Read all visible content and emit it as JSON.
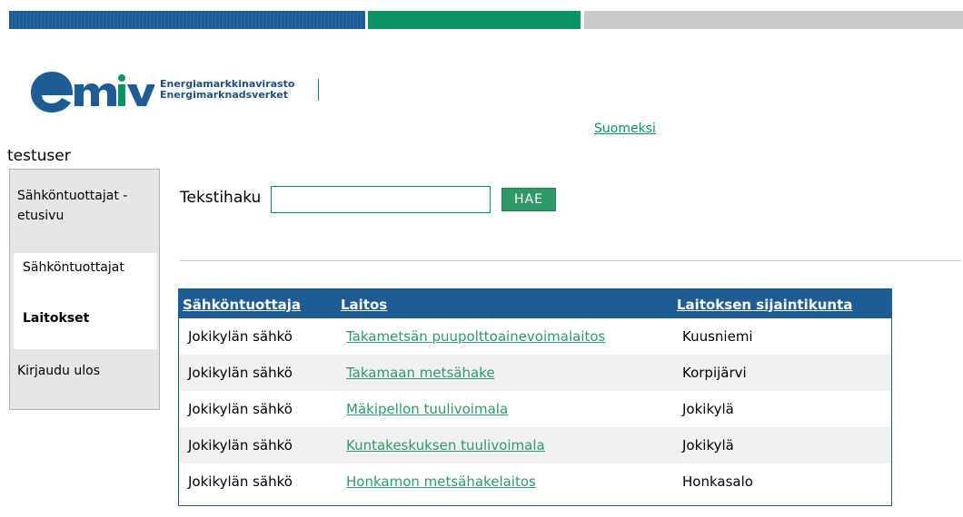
{
  "header": {
    "logo_line1": "Energiamarkkinavirasto",
    "logo_line2": "Energimarknadsverket",
    "language_link": "Suomeksi",
    "colors": {
      "blue": "#1f5b95",
      "green": "#089462",
      "gray": "#cacaca"
    }
  },
  "user": {
    "name": "testuser"
  },
  "sidebar": {
    "items": [
      {
        "label": "Sähköntuottajat - etusivu"
      },
      {
        "label": "Sähköntuottajat"
      },
      {
        "label": "Laitokset",
        "active": true
      },
      {
        "label": "Kirjaudu ulos"
      }
    ]
  },
  "search": {
    "label": "Tekstihaku",
    "value": "",
    "button_label": "HAE"
  },
  "table": {
    "headers": [
      "Sähköntuottaja",
      "Laitos",
      "Laitoksen sijaintikunta"
    ],
    "rows": [
      [
        "Jokikylän sähkö",
        "Takametsän puupolttoainevoimalaitos",
        "Kuusniemi"
      ],
      [
        "Jokikylän sähkö",
        "Takamaan metsähake",
        "Korpijärvi"
      ],
      [
        "Jokikylän sähkö",
        "Mäkipellon tuulivoimala",
        "Jokikylä"
      ],
      [
        "Jokikylän sähkö",
        "Kuntakeskuksen tuulivoimala",
        "Jokikylä"
      ],
      [
        "Jokikylän sähkö",
        "Honkamon metsähakelaitos",
        "Honkasalo"
      ]
    ]
  }
}
